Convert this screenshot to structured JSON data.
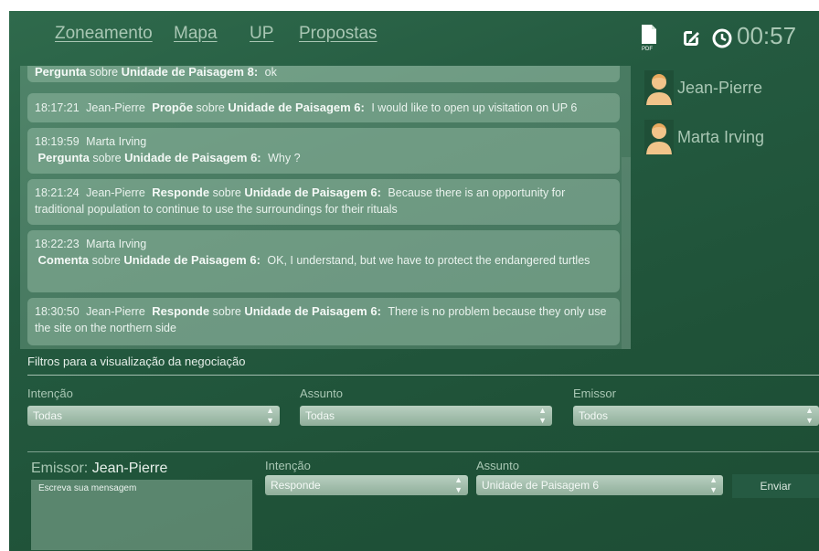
{
  "nav": {
    "links": [
      "Zoneamento",
      "Mapa",
      "UP",
      "Propostas"
    ]
  },
  "toolbar": {
    "pdf_icon": "pdf-icon",
    "edit_icon": "edit-icon",
    "clock_icon": "clock-icon",
    "timer": "00:57"
  },
  "chat": {
    "messages": [
      {
        "time": "",
        "author": "",
        "action": "Pergunta",
        "about": "sobre",
        "subject": "Unidade de Paisagem 8:",
        "text": "ok"
      },
      {
        "time": "18:17:21",
        "author": "Jean-Pierre",
        "action": "Propõe",
        "about": "sobre",
        "subject": "Unidade de Paisagem 6:",
        "text": "I would like to open up visitation on UP 6"
      },
      {
        "time": "18:19:59",
        "author": "Marta Irving",
        "action": "Pergunta",
        "about": "sobre",
        "subject": "Unidade de Paisagem 6:",
        "text": "Why ?"
      },
      {
        "time": "18:21:24",
        "author": "Jean-Pierre",
        "action": "Responde",
        "about": "sobre",
        "subject": "Unidade de Paisagem 6:",
        "text": "Because there is an opportunity for traditional population to continue to use the surroundings for their rituals"
      },
      {
        "time": "18:22:23",
        "author": "Marta Irving",
        "action": "Comenta",
        "about": "sobre",
        "subject": "Unidade de Paisagem 6:",
        "text": "OK, I understand, but we have to protect the endangered turtles"
      },
      {
        "time": "18:30:50",
        "author": "Jean-Pierre",
        "action": "Responde",
        "about": "sobre",
        "subject": "Unidade de Paisagem 6:",
        "text": "There is no problem because they only use the site on the northern side"
      }
    ]
  },
  "participants": [
    "Jean-Pierre",
    "Marta Irving"
  ],
  "filters": {
    "title": "Filtros para a visualização da negociação",
    "intencao": {
      "label": "Intenção",
      "value": "Todas"
    },
    "assunto": {
      "label": "Assunto",
      "value": "Todas"
    },
    "emissor": {
      "label": "Emissor",
      "value": "Todos"
    }
  },
  "compose": {
    "emitter_label": "Emissor:",
    "emitter_name": "Jean-Pierre",
    "placeholder": "Escreva sua mensagem",
    "intencao": {
      "label": "Intenção",
      "value": "Responde"
    },
    "assunto": {
      "label": "Assunto",
      "value": "Unidade de Paisagem 6"
    },
    "send_label": "Enviar"
  }
}
